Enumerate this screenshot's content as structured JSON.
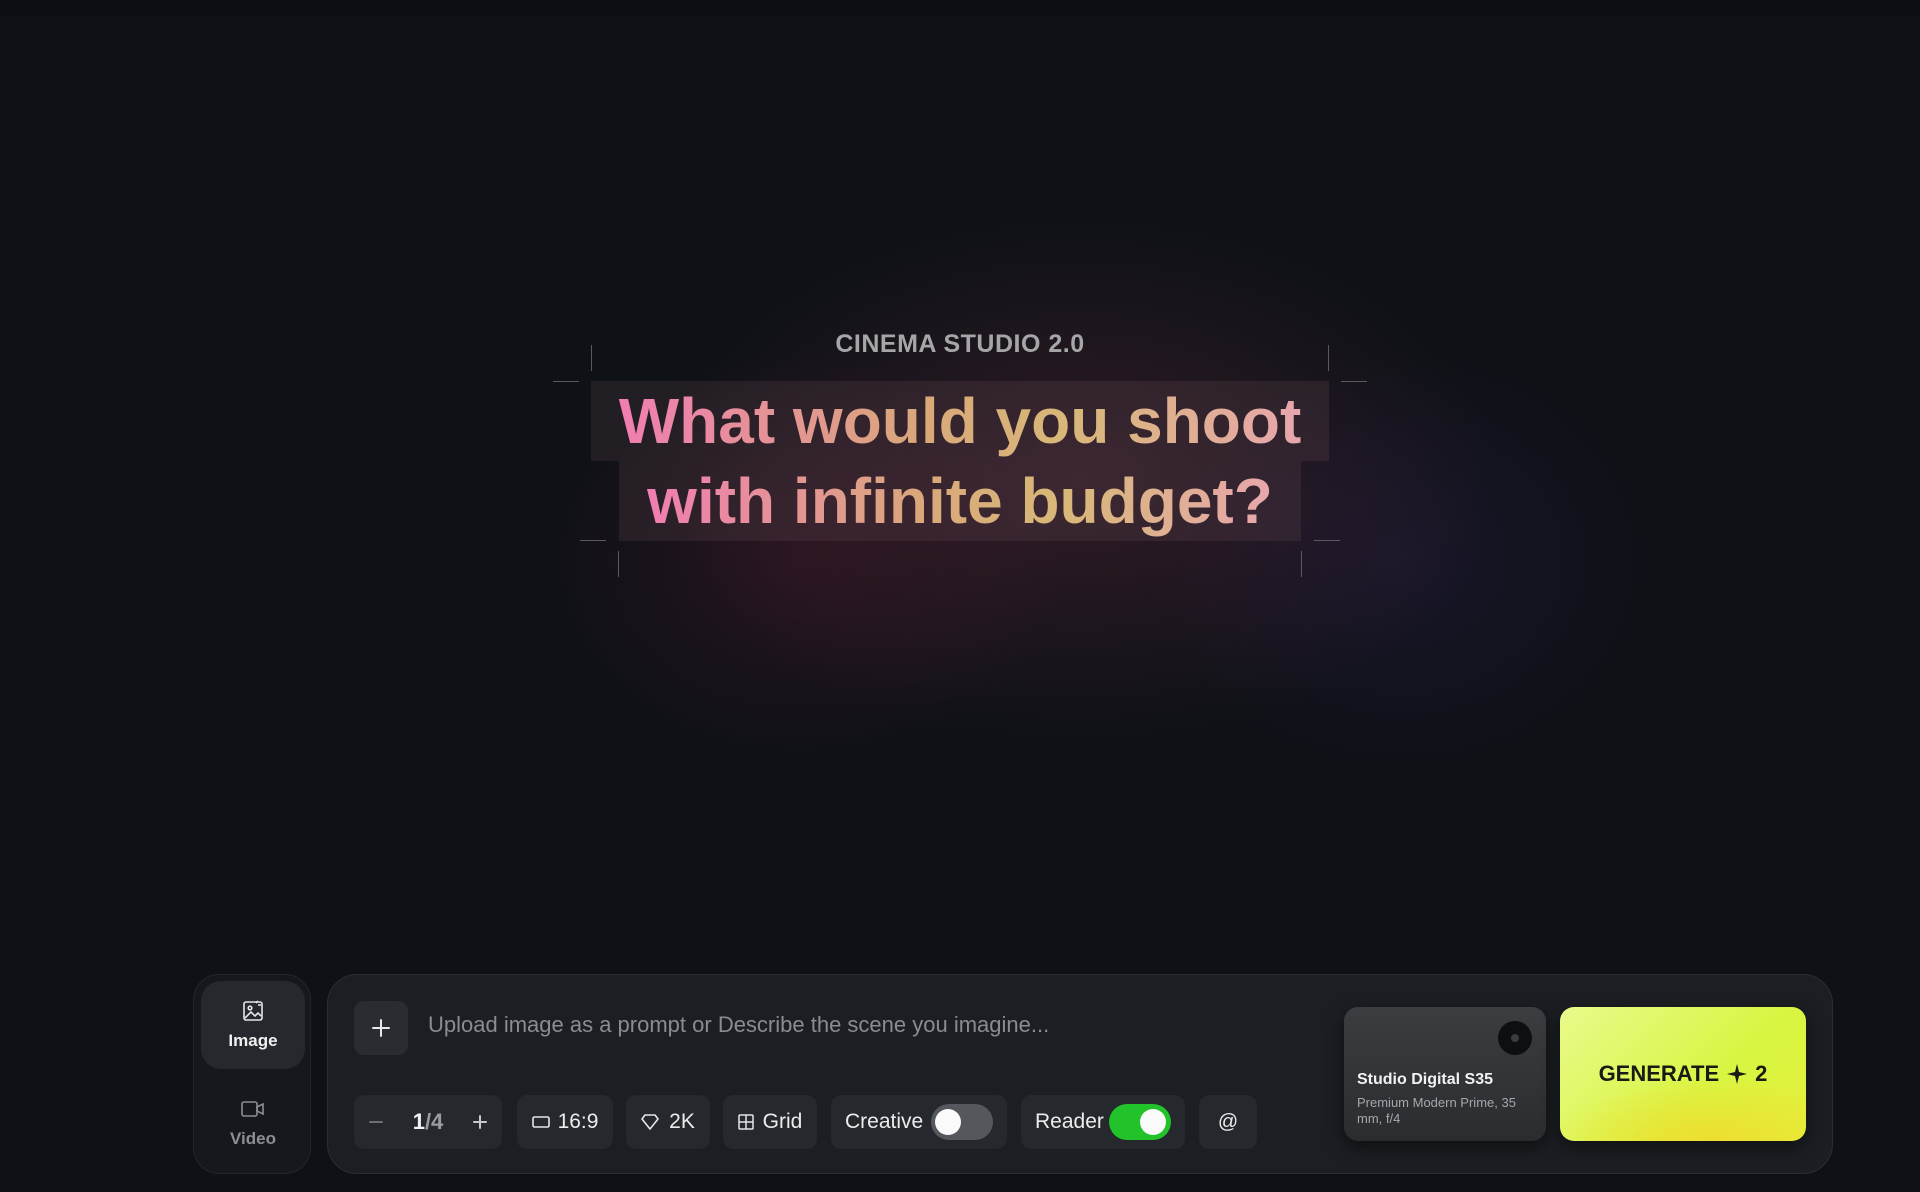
{
  "hero": {
    "eyebrow": "CINEMA STUDIO 2.0",
    "headline_line1": "What would you shoot",
    "headline_line2": "with infinite budget?"
  },
  "modes": [
    {
      "label": "Image",
      "icon": "image-icon",
      "active": true
    },
    {
      "label": "Video",
      "icon": "video-camera-icon",
      "active": false
    }
  ],
  "prompt": {
    "placeholder": "Upload image as a prompt or Describe the scene you imagine...",
    "value": ""
  },
  "controls": {
    "count_current": "1",
    "count_total": "/4",
    "aspect_ratio": "16:9",
    "resolution": "2K",
    "layout": "Grid",
    "creative_label": "Creative",
    "creative_on": false,
    "reader_label": "Reader",
    "reader_on": true,
    "mention_symbol": "@"
  },
  "camera": {
    "name": "Studio Digital S35",
    "lens": "Premium Modern Prime, 35 mm, f/4"
  },
  "generate": {
    "label": "GENERATE",
    "cost": "2"
  },
  "colors": {
    "accent_generate": "#d8f542",
    "toggle_on": "#22c22a",
    "toggle_off": "#55575c",
    "headline_pink": "#f27ab7",
    "headline_gold": "#d8b878"
  }
}
